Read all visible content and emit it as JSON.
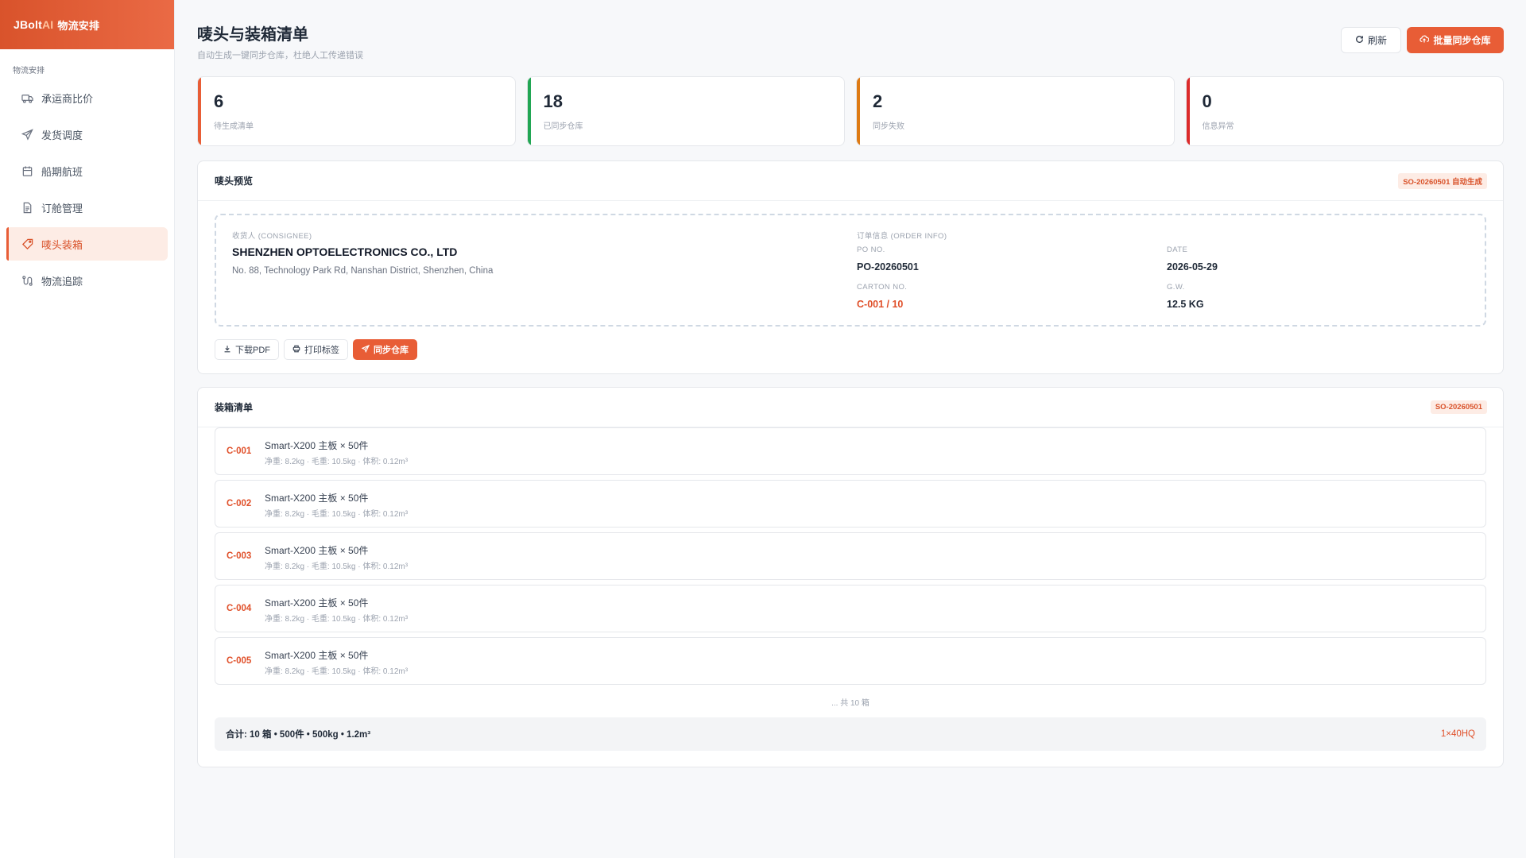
{
  "brand": {
    "name": "JBolt",
    "ai": "AI",
    "sub": "物流安排"
  },
  "sidebar": {
    "section": "物流安排",
    "items": [
      {
        "label": "承运商比价",
        "icon": "truck-icon"
      },
      {
        "label": "发货调度",
        "icon": "send-icon"
      },
      {
        "label": "船期航班",
        "icon": "calendar-icon"
      },
      {
        "label": "订舱管理",
        "icon": "document-icon"
      },
      {
        "label": "唛头装箱",
        "icon": "tag-icon",
        "active": true
      },
      {
        "label": "物流追踪",
        "icon": "route-icon"
      }
    ]
  },
  "header": {
    "title": "唛头与装箱清单",
    "subtitle": "自动生成一键同步仓库，杜绝人工传递错误",
    "refresh_label": "刷新",
    "batch_label": "批量同步仓库"
  },
  "stats": [
    {
      "value": "6",
      "label": "待生成清单",
      "color": "#e85d36"
    },
    {
      "value": "18",
      "label": "已同步仓库",
      "color": "#21a653"
    },
    {
      "value": "2",
      "label": "同步失败",
      "color": "#de7a14"
    },
    {
      "value": "0",
      "label": "信息异常",
      "color": "#dc2b2b"
    }
  ],
  "mark_preview": {
    "title": "唛头预览",
    "tag": "SO-20260501 自动生成",
    "consignee_label": "收货人 (CONSIGNEE)",
    "consignee_name": "SHENZHEN OPTOELECTRONICS CO., LTD",
    "consignee_address": "No. 88, Technology Park Rd, Nanshan District, Shenzhen, China",
    "order_info_label": "订单信息 (ORDER INFO)",
    "po_label": "PO NO.",
    "po_value": "PO-20260501",
    "date_label": "DATE",
    "date_value": "2026-05-29",
    "carton_label": "CARTON NO.",
    "carton_value": "C-001 / 10",
    "gw_label": "G.W.",
    "gw_value": "12.5 KG",
    "actions": {
      "download": "下载PDF",
      "print": "打印标签",
      "sync": "同步仓库"
    }
  },
  "packing": {
    "title": "装箱清单",
    "tag": "SO-20260501",
    "rows": [
      {
        "code": "C-001",
        "title": "Smart-X200 主板 × 50件",
        "meta": "净重: 8.2kg · 毛重: 10.5kg · 体积: 0.12m³"
      },
      {
        "code": "C-002",
        "title": "Smart-X200 主板 × 50件",
        "meta": "净重: 8.2kg · 毛重: 10.5kg · 体积: 0.12m³"
      },
      {
        "code": "C-003",
        "title": "Smart-X200 主板 × 50件",
        "meta": "净重: 8.2kg · 毛重: 10.5kg · 体积: 0.12m³"
      },
      {
        "code": "C-004",
        "title": "Smart-X200 主板 × 50件",
        "meta": "净重: 8.2kg · 毛重: 10.5kg · 体积: 0.12m³"
      },
      {
        "code": "C-005",
        "title": "Smart-X200 主板 × 50件",
        "meta": "净重: 8.2kg · 毛重: 10.5kg · 体积: 0.12m³"
      }
    ],
    "more": "... 共 10 箱",
    "summary": "合计: 10 箱 • 500件 • 500kg • 1.2m³",
    "container": "1×40HQ"
  }
}
